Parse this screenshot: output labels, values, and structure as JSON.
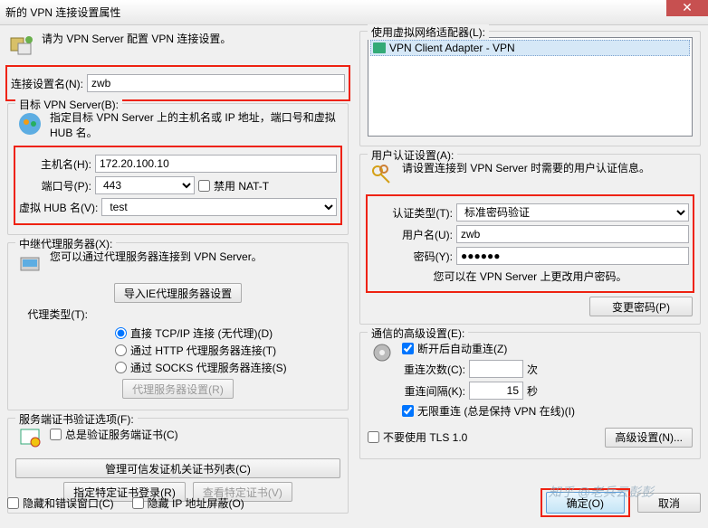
{
  "window": {
    "title": "新的 VPN 连接设置属性",
    "close": "✕"
  },
  "left": {
    "intro": "请为 VPN Server 配置 VPN 连接设置。",
    "conn_name_label": "连接设置名(N):",
    "conn_name_value": "zwb",
    "target_group": "目标 VPN Server(B):",
    "target_instruct": "指定目标 VPN Server 上的主机名或 IP 地址，端口号和虚拟 HUB 名。",
    "host_label": "主机名(H):",
    "host_value": "172.20.100.10",
    "port_label": "端口号(P):",
    "port_value": "443",
    "nat_t": "禁用 NAT-T",
    "hub_label": "虚拟 HUB 名(V):",
    "hub_value": "test",
    "proxy_group": "中继代理服务器(X):",
    "proxy_instruct": "您可以通过代理服务器连接到 VPN Server。",
    "import_ie": "导入IE代理服务器设置",
    "proxy_type_label": "代理类型(T):",
    "proxy_r1": "直接 TCP/IP 连接 (无代理)(D)",
    "proxy_r2": "通过 HTTP 代理服务器连接(T)",
    "proxy_r3": "通过 SOCKS 代理服务器连接(S)",
    "proxy_settings_btn": "代理服务器设置(R)",
    "cert_group": "服务端证书验证选项(F):",
    "cert_always": "总是验证服务端证书(C)",
    "cert_manage": "管理可信发证机关证书列表(C)",
    "cert_specify": "指定特定证书登录(R)",
    "cert_view": "查看特定证书(V)",
    "hide_err": "隐藏和错误窗口(C)",
    "hide_ip": "隐藏 IP 地址屏蔽(O)"
  },
  "right": {
    "adapter_group": "使用虚拟网络适配器(L):",
    "adapter_item": "VPN Client Adapter - VPN",
    "auth_group": "用户认证设置(A):",
    "auth_instruct": "请设置连接到 VPN Server 时需要的用户认证信息。",
    "auth_type_label": "认证类型(T):",
    "auth_type_value": "标准密码验证",
    "user_label": "用户名(U):",
    "user_value": "zwb",
    "pwd_label": "密码(Y):",
    "pwd_value": "●●●●●●",
    "pwd_note": "您可以在 VPN Server 上更改用户密码。",
    "change_pwd_btn": "变更密码(P)",
    "adv_group": "通信的高级设置(E):",
    "reconnect_chk": "断开后自动重连(Z)",
    "retry_count_label": "重连次数(C):",
    "retry_count_unit": "次",
    "retry_interval_label": "重连间隔(K):",
    "retry_interval_value": "15",
    "retry_interval_unit": "秒",
    "infinite_chk": "无限重连 (总是保持 VPN 在线)(I)",
    "no_tls": "不要使用 TLS 1.0",
    "adv_btn": "高级设置(N)...",
    "ok": "确定(O)",
    "cancel": "取消"
  },
  "watermark": "知乎 @老兵云彭彭"
}
